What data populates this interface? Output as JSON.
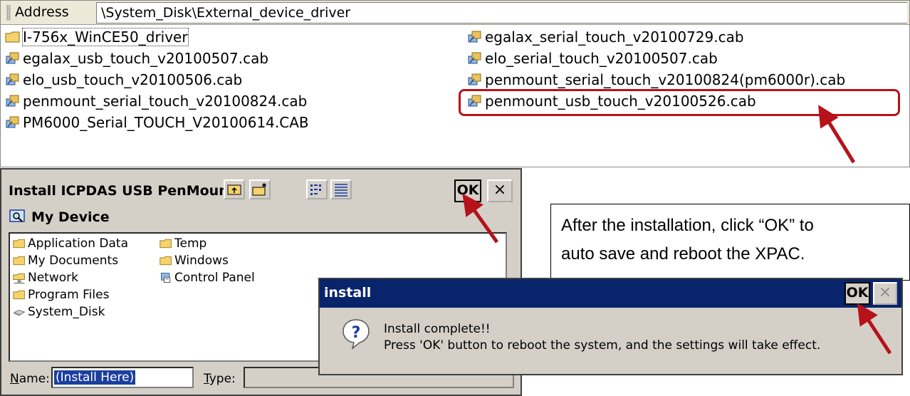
{
  "explorer": {
    "address_label": "Address",
    "address_value": "\\System_Disk\\External_device_driver",
    "files_left": [
      {
        "name": "I-756x_WinCE50_driver",
        "icon": "folder-icon"
      },
      {
        "name": "egalax_usb_touch_v20100507.cab",
        "icon": "cab-file-icon"
      },
      {
        "name": "elo_usb_touch_v20100506.cab",
        "icon": "cab-file-icon"
      },
      {
        "name": "penmount_serial_touch_v20100824.cab",
        "icon": "cab-file-icon"
      },
      {
        "name": "PM6000_Serial_TOUCH_V20100614.CAB",
        "icon": "cab-file-icon"
      }
    ],
    "files_right": [
      {
        "name": "egalax_serial_touch_v20100729.cab",
        "icon": "cab-file-icon"
      },
      {
        "name": "elo_serial_touch_v20100507.cab",
        "icon": "cab-file-icon"
      },
      {
        "name": "penmount_serial_touch_v20100824(pm6000r).cab",
        "icon": "cab-file-icon"
      },
      {
        "name": "penmount_usb_touch_v20100526.cab",
        "icon": "cab-file-icon"
      }
    ]
  },
  "install_dialog": {
    "title": "Install ICPDAS USB PenMount",
    "ok_label": "OK",
    "close_label": "×",
    "location": "My Device",
    "folders_col1": [
      {
        "name": "Application Data",
        "icon": "folder-icon"
      },
      {
        "name": "My Documents",
        "icon": "folder-icon"
      },
      {
        "name": "Network",
        "icon": "network-folder-icon"
      },
      {
        "name": "Program Files",
        "icon": "folder-icon"
      },
      {
        "name": "System_Disk",
        "icon": "disk-icon"
      }
    ],
    "folders_col2": [
      {
        "name": "Temp",
        "icon": "folder-icon"
      },
      {
        "name": "Windows",
        "icon": "folder-icon"
      },
      {
        "name": "Control Panel",
        "icon": "control-panel-icon"
      }
    ],
    "name_label": "Name:",
    "name_value": "(Install Here)",
    "type_label": "Type:"
  },
  "callout": {
    "line1": "After the installation, click “OK” to",
    "line2": "auto save and reboot the XPAC."
  },
  "message_box": {
    "title": "install",
    "ok_label": "OK",
    "close_label": "×",
    "line1": "Install complete!!",
    "line2": "Press 'OK' button to reboot the system, and the settings will take effect."
  },
  "colors": {
    "highlight": "#b5121b",
    "titlebar": "#08246b",
    "dialog_face": "#d4d0c8",
    "selection": "#1c3f9e"
  }
}
